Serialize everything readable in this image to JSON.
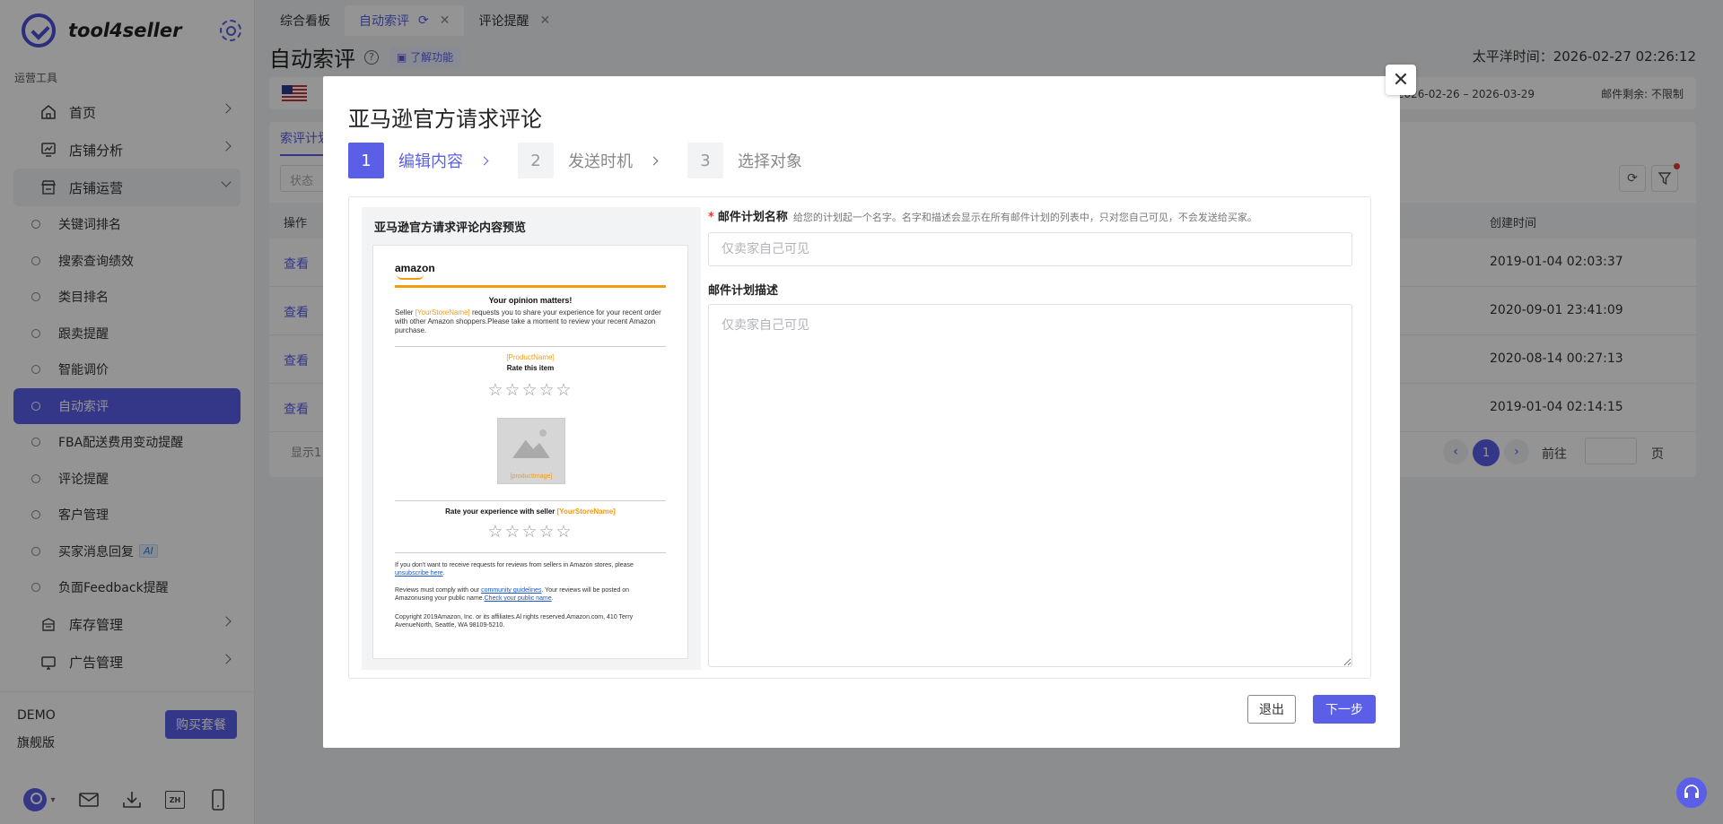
{
  "app": {
    "name": "tool4seller"
  },
  "sidebar": {
    "section_title": "运营工具",
    "top_items": [
      {
        "label": "首页",
        "icon": "home-icon"
      },
      {
        "label": "店铺分析",
        "icon": "chart-icon"
      },
      {
        "label": "店铺运营",
        "icon": "store-icon"
      }
    ],
    "sub_items": [
      {
        "label": "关键词排名"
      },
      {
        "label": "搜索查询绩效"
      },
      {
        "label": "类目排名"
      },
      {
        "label": "跟卖提醒"
      },
      {
        "label": "智能调价"
      },
      {
        "label": "自动索评"
      },
      {
        "label": "FBA配送费用变动提醒"
      },
      {
        "label": "评论提醒"
      },
      {
        "label": "客户管理"
      },
      {
        "label": "买家消息回复",
        "badge": "AI"
      },
      {
        "label": "负面Feedback提醒"
      }
    ],
    "bottom_items": [
      {
        "label": "库存管理",
        "icon": "inventory-icon"
      },
      {
        "label": "广告管理",
        "icon": "ads-icon"
      }
    ],
    "footer": {
      "plan_name": "DEMO",
      "plan_tier": "旗舰版",
      "buy_label": "购买套餐",
      "lang_label": "ZH"
    }
  },
  "tabs": [
    {
      "label": "综合看板"
    },
    {
      "label": "自动索评"
    },
    {
      "label": "评论提醒"
    }
  ],
  "page": {
    "title": "自动索评",
    "learn_label": "了解功能",
    "pacific_time": "太平洋时间：2026-02-27 02:26:12",
    "valid_range": "时间: 2026-02-26 – 2026-03-29",
    "remaining": "邮件剩余: 不限制",
    "sub_tab": "索评计划",
    "status_placeholder": "状态",
    "table": {
      "col_action": "操作",
      "col_created": "创建时间",
      "rows": [
        {
          "action": "查看",
          "created": "2019-01-04 02:03:37"
        },
        {
          "action": "查看",
          "created": "2020-09-01 23:41:09"
        },
        {
          "action": "查看",
          "created": "2020-08-14 00:27:13"
        },
        {
          "action": "查看",
          "created": "2019-01-04 02:14:15"
        }
      ]
    },
    "pager": {
      "total": "显示1",
      "current": "1",
      "goto_label": "前往",
      "page_suffix": "页"
    }
  },
  "modal": {
    "title": "亚马逊官方请求评论",
    "steps": [
      {
        "num": "1",
        "label": "编辑内容"
      },
      {
        "num": "2",
        "label": "发送时机"
      },
      {
        "num": "3",
        "label": "选择对象"
      }
    ],
    "preview": {
      "title": "亚马逊官方请求评论内容预览",
      "logo": "amazon",
      "heading": "Your opinion matters!",
      "intro_a": "Seller ",
      "intro_store": "[YourStoreName]",
      "intro_b": " requests you to share your experience for your recent order with other Amazon shoppers.Please take a moment to review your recent Amazon purchase.",
      "product_name": "[ProductName]",
      "rate_item": "Rate this item",
      "stars": "☆☆☆☆☆",
      "image_label": "[productImage]",
      "rate_seller_a": "Rate your experience with seller ",
      "rate_seller_store": "[YourStoreName]",
      "unsub_a": "If you don't want to receive requests for reviews from sellers in Amazon stores, please ",
      "unsub_link": "unsubscribe here",
      "unsub_b": ".",
      "comply_a": "Reviews must comply with our ",
      "comply_link1": "community guidelines",
      "comply_b": ". Your reviews will be posted on Amazonusing your public name.",
      "comply_link2": "Check your public name",
      "comply_c": ".",
      "copyright": "Copyright 2019Amazon, Inc. or its affiliates.Al rights reserved.Amazon.com, 410 Terry AvenueNorth, Seattle, WA 98109-5210."
    },
    "form": {
      "name_label": "邮件计划名称",
      "name_hint": "给您的计划起一个名字。名字和描述会显示在所有邮件计划的列表中，只对您自己可见，不会发送给买家。",
      "name_placeholder": "仅卖家自己可见",
      "desc_label": "邮件计划描述",
      "desc_placeholder": "仅卖家自己可见"
    },
    "exit_label": "退出",
    "next_label": "下一步"
  },
  "colors": {
    "accent": "#5b5fe8",
    "placeholder_orange": "#f39c12",
    "required": "#e53935"
  }
}
